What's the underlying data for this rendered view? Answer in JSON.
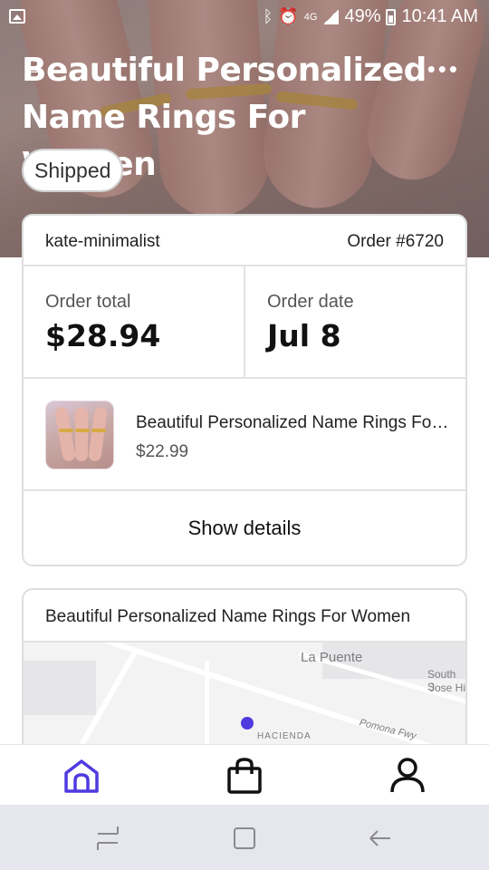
{
  "status_bar": {
    "battery": "49%",
    "time": "10:41 AM",
    "icons": [
      "gallery-icon",
      "bluetooth-icon",
      "alarm-icon",
      "4g-icon",
      "signal-icon",
      "battery-icon"
    ]
  },
  "hero": {
    "title": "Beautiful Personalized Name Rings For Women",
    "status": "Shipped"
  },
  "order": {
    "shop": "kate-minimalist",
    "number": "Order #6720",
    "total_label": "Order total",
    "total_value": "$28.94",
    "date_label": "Order date",
    "date_value": "Jul 8",
    "item_name": "Beautiful Personalized Name Rings For Women",
    "item_price": "$22.99",
    "details_label": "Show details"
  },
  "map_card": {
    "title": "Beautiful Personalized Name Rings For Women",
    "labels": {
      "la_puente": "La Puente",
      "south_san_jose_1": "South S",
      "south_san_jose_2": "Jose Hi",
      "pomona_fwy": "Pomona Fwy",
      "hacienda": "HACIENDA"
    }
  },
  "bottom_nav": [
    "home-icon",
    "bag-icon",
    "profile-icon"
  ],
  "colors": {
    "accent": "#4f3ae0",
    "text": "#222222",
    "border": "#dedede"
  }
}
